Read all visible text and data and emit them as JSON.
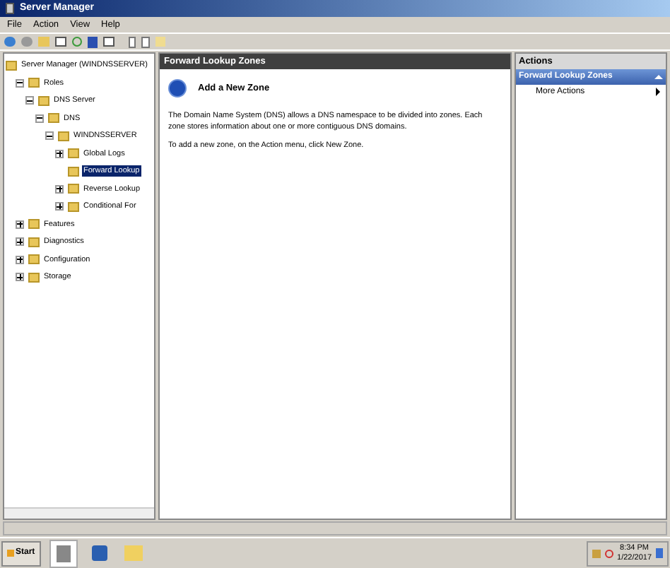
{
  "window": {
    "title": "Server Manager"
  },
  "menu": [
    "File",
    "Action",
    "View",
    "Help"
  ],
  "tree": {
    "label": "Server Manager (WINDNSSERVER)",
    "selected": false,
    "children": [
      {
        "label": "Roles",
        "expanded": true,
        "selected": false,
        "children": [
          {
            "label": "DNS Server",
            "expanded": true,
            "selected": false,
            "children": [
              {
                "label": "DNS",
                "expanded": true,
                "selected": false,
                "children": [
                  {
                    "label": "WINDNSSERVER",
                    "expanded": true,
                    "selected": false,
                    "children": [
                      {
                        "label": "Global Logs",
                        "expanded": false,
                        "selected": false
                      },
                      {
                        "label": "Forward Lookup",
                        "selected": true
                      },
                      {
                        "label": "Reverse Lookup",
                        "expanded": false,
                        "selected": false
                      },
                      {
                        "label": "Conditional For",
                        "expanded": false,
                        "selected": false
                      }
                    ]
                  }
                ]
              }
            ]
          }
        ]
      },
      {
        "label": "Features",
        "expanded": false,
        "selected": false
      },
      {
        "label": "Diagnostics",
        "expanded": false,
        "selected": false
      },
      {
        "label": "Configuration",
        "expanded": false,
        "selected": false
      },
      {
        "label": "Storage",
        "expanded": false,
        "selected": false
      }
    ]
  },
  "content": {
    "header": "Forward Lookup Zones",
    "heading": "Add a New Zone",
    "paragraphs": [
      "The Domain Name System (DNS) allows a DNS namespace to be divided into zones. Each zone stores information about one or more contiguous DNS domains.",
      "To add a new zone, on the Action menu, click New Zone."
    ]
  },
  "actions": {
    "title": "Actions",
    "section": "Forward Lookup Zones",
    "items": [
      "More Actions"
    ]
  },
  "taskbar": {
    "start": "Start",
    "time": "8:34 PM",
    "date": "1/22/2017"
  }
}
